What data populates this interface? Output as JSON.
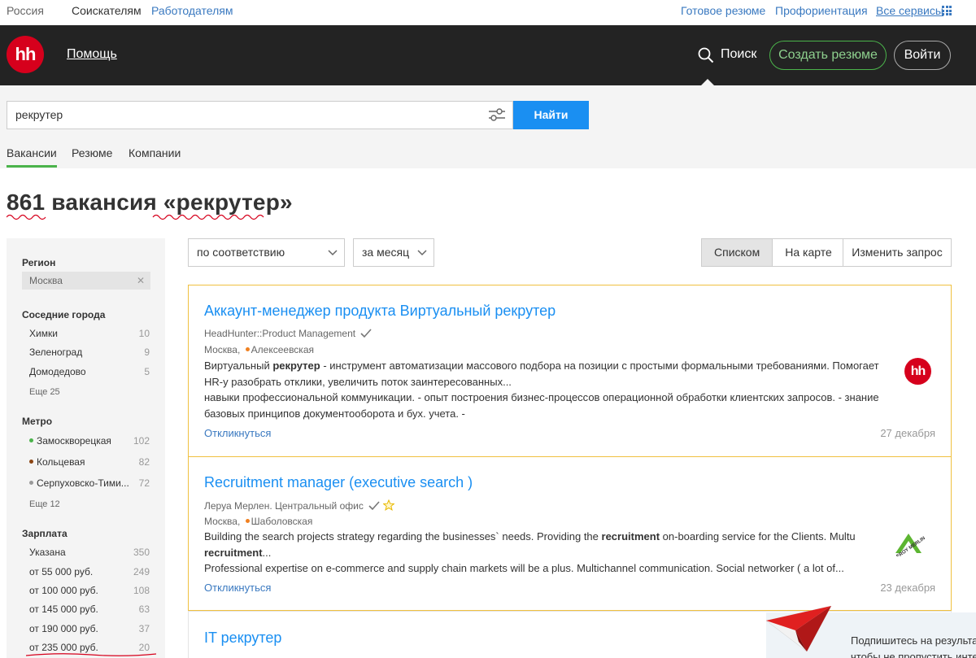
{
  "topbar": {
    "region": "Россия",
    "seekers": "Соискателям",
    "employers": "Работодателям",
    "ready_resume": "Готовое резюме",
    "career_guidance": "Профориентация",
    "all_services": "Все сервисы"
  },
  "header": {
    "logo_text": "hh",
    "help": "Помощь",
    "search": "Поиск",
    "create_resume": "Создать резюме",
    "login": "Войти"
  },
  "search": {
    "query": "рекрутер",
    "find_button": "Найти",
    "tabs": [
      {
        "label": "Вакансии",
        "active": true
      },
      {
        "label": "Резюме",
        "active": false
      },
      {
        "label": "Компании",
        "active": false
      }
    ]
  },
  "results": {
    "title": "861 вакансия «рекрутер»"
  },
  "sidebar": {
    "region_head": "Регион",
    "region_value": "Москва",
    "cities_head": "Соседние города",
    "cities": [
      {
        "name": "Химки",
        "count": "10"
      },
      {
        "name": "Зеленоград",
        "count": "9"
      },
      {
        "name": "Домодедово",
        "count": "5"
      }
    ],
    "cities_more": "Еще 25",
    "metro_head": "Метро",
    "metro": [
      {
        "name": "Замоскворецкая",
        "count": "102",
        "color": "#4bb34b"
      },
      {
        "name": "Кольцевая",
        "count": "82",
        "color": "#8b4513"
      },
      {
        "name": "Серпуховско-Тими...",
        "count": "72",
        "color": "#999999"
      }
    ],
    "metro_more": "Еще 12",
    "salary_head": "Зарплата",
    "salary": [
      {
        "name": "Указана",
        "count": "350"
      },
      {
        "name": "от 55 000 руб.",
        "count": "249"
      },
      {
        "name": "от 100 000 руб.",
        "count": "108"
      },
      {
        "name": "от 145 000 руб.",
        "count": "63"
      },
      {
        "name": "от 190 000 руб.",
        "count": "37"
      },
      {
        "name": "от 235 000 руб.",
        "count": "20"
      }
    ]
  },
  "controls": {
    "sort": "по соответствию",
    "period": "за месяц",
    "view_list": "Списком",
    "view_map": "На карте",
    "change_query": "Изменить запрос"
  },
  "vacancies": [
    {
      "title": "Аккаунт-менеджер продукта Виртуальный рекрутер",
      "company": "HeadHunter::Product Management",
      "city": "Москва,",
      "metro": "Алексеевская",
      "desc1_a": "Виртуальный ",
      "desc1_b": "рекрутер",
      "desc1_c": " - инструмент автоматизации массового подбора на позиции с простыми формальными требованиями. Помогает HR-у разобрать отклики, увеличить поток заинтересованных...",
      "desc2": "навыки профессиональной коммуникации. - опыт построения бизнес-процессов операционной обработки клиентских запросов. - знание базовых принципов документооборота и бух. учета. -",
      "apply": "Откликнуться",
      "date": "27 декабря",
      "logo_text": "hh"
    },
    {
      "title": "Recruitment  manager (executive search )",
      "company": "Леруа Мерлен. Центральный офис",
      "city": "Москва,",
      "metro": "Шаболовская",
      "desc1_a": "Building the search projects strategy regarding the businesses` needs. Providing the ",
      "desc1_b": "recruitment",
      "desc1_c": " on-boarding service for the Clients. Multu ",
      "desc1_d": "recruitment",
      "desc1_e": "...",
      "desc2": "Professional expertise on e-commerce and supply chain markets will be a plus. Multichannel communication. Social networker ( a lot of...",
      "apply": "Откликнуться",
      "date": "23 декабря",
      "logo_text": "LEROY MERLIN"
    },
    {
      "title": "IT рекрутер"
    }
  ],
  "popup": {
    "line1": "Подпишитесь на результа",
    "line2": "чтобы не пропустить инте"
  },
  "colors": {
    "header_bg": "#232323",
    "brand_red": "#d6001c",
    "link_blue": "#1a8ff2",
    "accent_green": "#4bb34b",
    "card_border": "#f0c040"
  }
}
